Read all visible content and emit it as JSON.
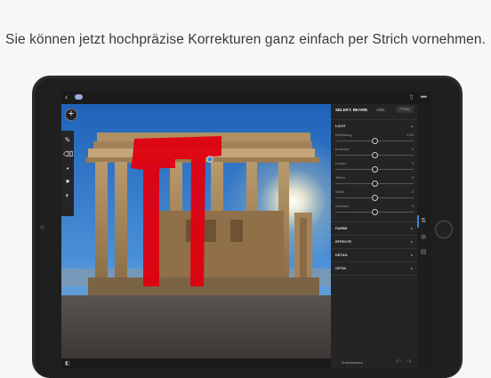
{
  "headline": "Sie können jetzt hochpräzise Korrekturen ganz einfach per Strich vornehmen.",
  "topbar": {
    "back": "‹",
    "share": "⇧",
    "more": "•••"
  },
  "left_tools": {
    "add": "+",
    "brush": "✎",
    "eraser": "⌫"
  },
  "panel": {
    "title": "SELEKT. BEARB.",
    "cancel": "Abbr.",
    "done": "Fertig",
    "light_section": "LICHT",
    "sliders": [
      {
        "label": "Belichtung",
        "value": "0,00",
        "position": 0.5
      },
      {
        "label": "Kontrast",
        "value": "0",
        "position": 0.5
      },
      {
        "label": "Lichter",
        "value": "0",
        "position": 0.5
      },
      {
        "label": "Tiefen",
        "value": "0",
        "position": 0.5
      },
      {
        "label": "Weiß",
        "value": "0",
        "position": 0.5
      },
      {
        "label": "Schwarz",
        "value": "0",
        "position": 0.5
      }
    ],
    "sections": [
      "FARBE",
      "EFFEKTE",
      "DETAIL",
      "OPTIK"
    ],
    "reset": "Zurücksetzen"
  },
  "colors": {
    "mask": "#e00010",
    "accent": "#3b86d4",
    "panel_bg": "#242424"
  }
}
